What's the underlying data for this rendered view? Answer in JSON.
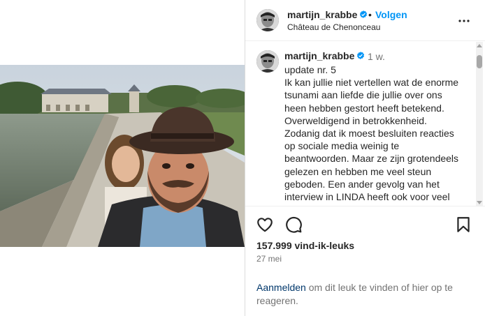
{
  "post": {
    "username": "martijn_krabbe",
    "follow_label": "Volgen",
    "separator": "•",
    "location": "Château de Chenonceau",
    "caption_username": "martijn_krabbe",
    "caption_time": "1 w.",
    "caption_text": "update nr. 5\nIk kan jullie niet vertellen wat de enorme tsunami aan liefde die jullie over ons heen hebben gestort heeft betekend. Overweldigend in betrokkenheid. Zodanig dat ik moest besluiten reacties op sociale media weinig te beantwoorden. Maar ze zijn grotendeels gelezen en hebben me veel steun geboden. Een ander gevolg van het interview in LINDA heeft ook voor veel mensen iets betekend, dat heeft",
    "likes": "157.999 vind-ik-leuks",
    "date": "27 mei",
    "login_link": "Aanmelden",
    "login_text": " om dit leuk te vinden of hier op te reageren."
  },
  "icons": {
    "verified": "verified-badge-icon",
    "more": "more-options-icon",
    "like": "heart-icon",
    "comment": "speech-bubble-icon",
    "save": "bookmark-icon"
  },
  "colors": {
    "accent": "#0095f6",
    "link": "#00376b",
    "muted": "#737373",
    "text": "#262626"
  }
}
